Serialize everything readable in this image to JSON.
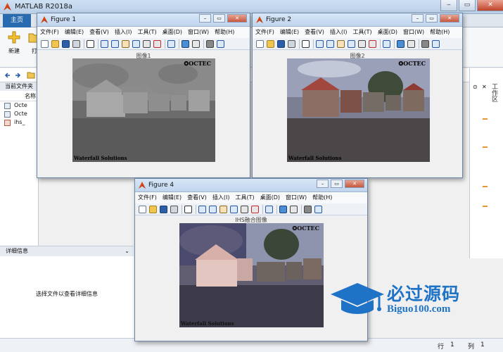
{
  "app": {
    "title": "MATLAB R2018a"
  },
  "ribbon": {
    "home_tab": "主页",
    "new_label": "新建",
    "open_label": "打"
  },
  "folder_panel": {
    "header": "当前文件夹",
    "name_column": "名称",
    "files": [
      "Octe",
      "Octe",
      "ihs_"
    ]
  },
  "detail_panel": {
    "header": "详细信息",
    "message": "选择文件以查看详细信息"
  },
  "workspace_panel": {
    "label": "工作区"
  },
  "status_bar": {
    "row_label": "行",
    "row_value": "1",
    "col_label": "列",
    "col_value": "1"
  },
  "figures": [
    {
      "title": "Figure 1",
      "menu": [
        "文件(F)",
        "编辑(E)",
        "查看(V)",
        "插入(I)",
        "工具(T)",
        "桌面(D)",
        "窗口(W)",
        "帮助(H)"
      ],
      "image_title": "图像1",
      "watermark_left": "Waterfall Solutions",
      "watermark_right": "✪OCTEC"
    },
    {
      "title": "Figure 2",
      "menu": [
        "文件(F)",
        "编辑(E)",
        "查看(V)",
        "插入(I)",
        "工具(T)",
        "桌面(D)",
        "窗口(W)",
        "帮助(H)"
      ],
      "image_title": "图像2",
      "watermark_left": "Waterfall Solutions",
      "watermark_right": "✪OCTEC"
    },
    {
      "title": "Figure 4",
      "menu": [
        "文件(F)",
        "编辑(E)",
        "查看(V)",
        "插入(I)",
        "工具(T)",
        "桌面(D)",
        "窗口(W)",
        "帮助(H)"
      ],
      "image_title": "IHS融合图像",
      "watermark_left": "Waterfall Solutions",
      "watermark_right": "✪OCTEC"
    }
  ],
  "overlay_logo": {
    "cn": "必过源码",
    "en": "Biguo100.com"
  },
  "colors": {
    "accent": "#2a6bb0",
    "logo_blue": "#1e73c7"
  }
}
